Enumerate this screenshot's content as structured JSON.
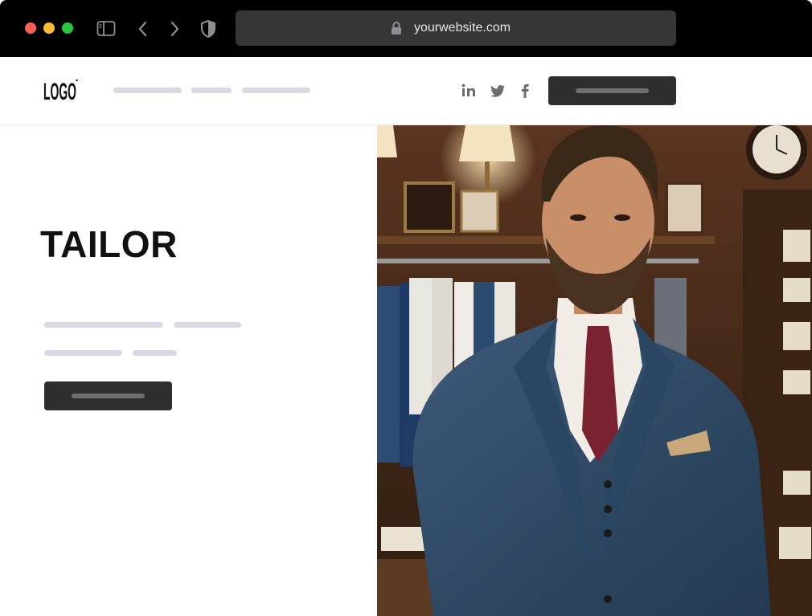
{
  "browser": {
    "url": "yourwebsite.com",
    "icons": [
      "sidebar-icon",
      "back-icon",
      "forward-icon",
      "shield-icon",
      "lock-icon"
    ]
  },
  "header": {
    "logo_text": "LOGO",
    "social": [
      "linkedin-icon",
      "twitter-icon",
      "facebook-icon"
    ]
  },
  "hero": {
    "title": "TAILOR",
    "image_alt": "Man in a blue three-piece suit standing in a tailor shop"
  },
  "colors": {
    "browser_bar": "#000000",
    "address_bar": "#363636",
    "button": "#2e2e2e",
    "placeholder_line": "#d9d9e6"
  }
}
